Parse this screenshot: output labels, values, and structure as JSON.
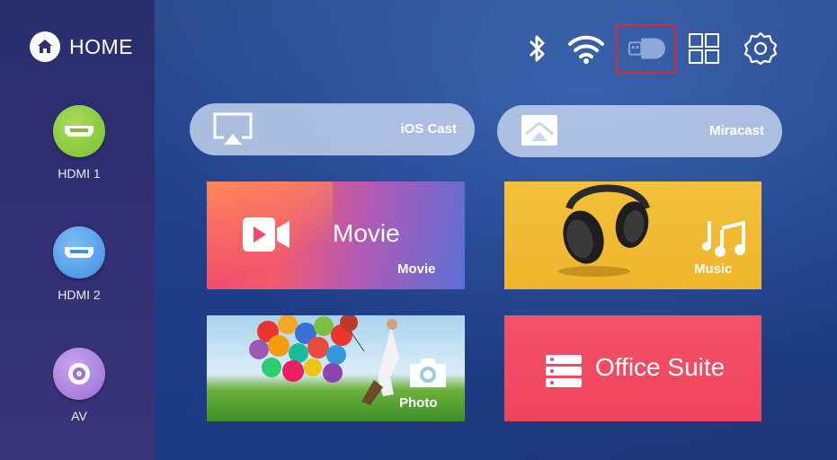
{
  "sidebar": {
    "home_label": "HOME",
    "sources": [
      {
        "label": "HDMI 1",
        "icon": "hdmi-icon",
        "color": "#7bbf2e"
      },
      {
        "label": "HDMI 2",
        "icon": "hdmi-icon",
        "color": "#3f8fe0"
      },
      {
        "label": "AV",
        "icon": "av-icon",
        "color": "#9a6fd6"
      }
    ]
  },
  "status_bar": {
    "icons": [
      "bluetooth-icon",
      "wifi-icon",
      "usb-storage-icon",
      "apps-grid-icon",
      "settings-gear-icon"
    ],
    "highlight_color": "#e3262b"
  },
  "cast": {
    "ios_label": "iOS Cast",
    "miracast_label": "Miracast"
  },
  "tiles": {
    "movie_big": "Movie",
    "movie_small": "Movie",
    "music_small": "Music",
    "photo_small": "Photo",
    "office_big": "Office Suite"
  }
}
